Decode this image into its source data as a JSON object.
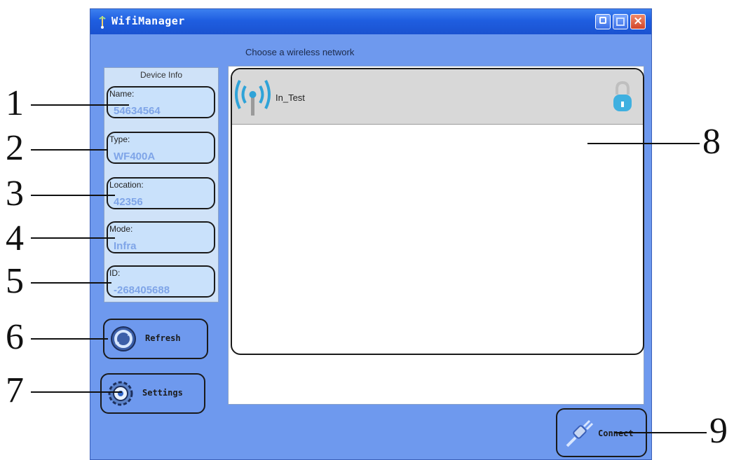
{
  "window": {
    "title": "WifiManager",
    "controls": {
      "minimize": "minimize",
      "maximize": "maximize",
      "close": "×"
    }
  },
  "main": {
    "choose_label": "Choose a wireless network"
  },
  "device_info": {
    "title": "Device Info",
    "fields": [
      {
        "label": "Name:",
        "value": "54634564"
      },
      {
        "label": "Type:",
        "value": "WF400A"
      },
      {
        "label": "Location:",
        "value": "42356"
      },
      {
        "label": "Mode:",
        "value": "Infra"
      },
      {
        "label": "ID:",
        "value": "-268405688"
      }
    ]
  },
  "buttons": {
    "refresh": "Refresh",
    "settings": "Settings",
    "connect": "Connect"
  },
  "networks": [
    {
      "ssid": "In_Test",
      "secured": true,
      "signal_icon": "wifi-signal-icon",
      "lock_icon": "lock-icon"
    }
  ],
  "callouts": [
    "1",
    "2",
    "3",
    "4",
    "5",
    "6",
    "7",
    "8",
    "9"
  ],
  "colors": {
    "window_bg": "#6e99ee",
    "titlebar": "#1f5ee0",
    "field_bg": "#c9e1fb",
    "field_value": "#7fa5e8",
    "list_row": "#d8d8d8"
  }
}
